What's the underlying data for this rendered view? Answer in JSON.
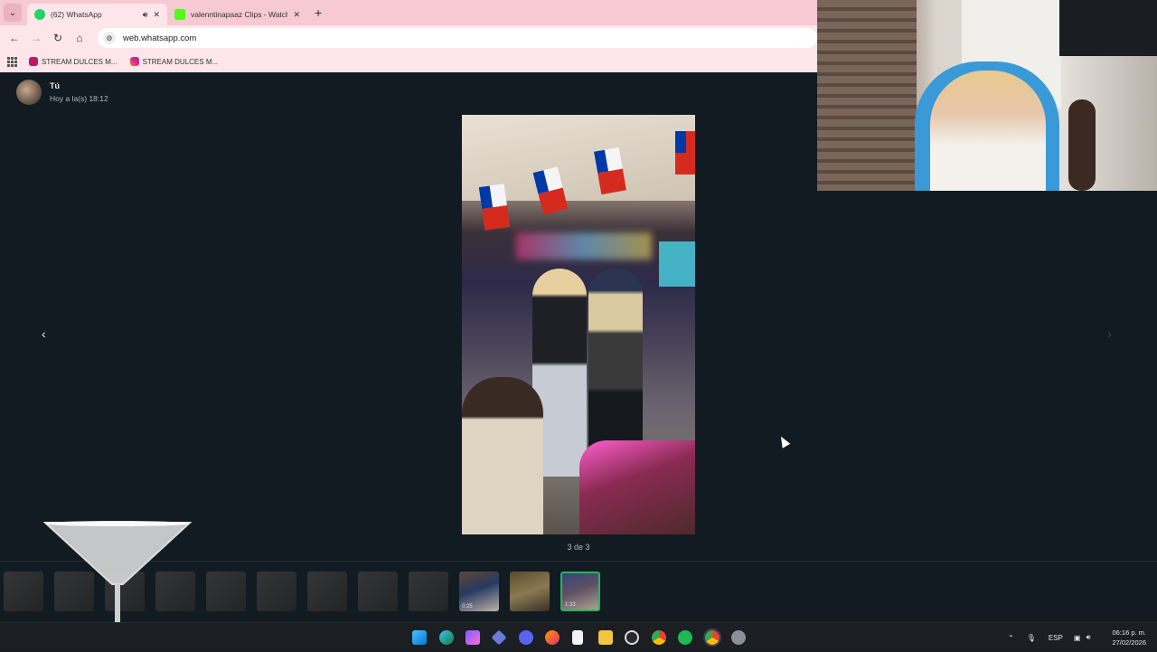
{
  "browser": {
    "tabs": [
      {
        "title": "(62) WhatsApp",
        "active": true,
        "favicon_color": "#25d366"
      },
      {
        "title": "valenntinapaaz Clips - Watch Li",
        "active": false,
        "favicon_color": "#53fc18"
      }
    ],
    "new_tab_label": "+",
    "url": "web.whatsapp.com",
    "bookmarks": [
      {
        "label": "STREAM DULCES M...",
        "color": "#c2185b"
      },
      {
        "label": "STREAM DULCES M...",
        "color": "#e1306c"
      }
    ]
  },
  "viewer": {
    "sender_name": "Tú",
    "sender_time": "Hoy a la(s) 18:12",
    "counter": "3 de 3",
    "prev_arrow": "‹",
    "next_arrow": "›",
    "thumbnails": [
      {
        "type": "image"
      },
      {
        "type": "image"
      },
      {
        "type": "image"
      },
      {
        "type": "image"
      },
      {
        "type": "image"
      },
      {
        "type": "image"
      },
      {
        "type": "image"
      },
      {
        "type": "image"
      },
      {
        "type": "image"
      },
      {
        "type": "video",
        "duration": "0:25"
      },
      {
        "type": "image"
      },
      {
        "type": "video",
        "duration": "1:33",
        "selected": true
      }
    ]
  },
  "taskbar": {
    "icons": [
      "windows-start",
      "edge",
      "copilot",
      "dropbox",
      "discord",
      "firefox",
      "notepad",
      "file-explorer",
      "obs",
      "chrome",
      "spotify",
      "chrome-alt",
      "settings"
    ],
    "tray_lang": "ESP",
    "time": "06:16 p. m.",
    "date": "27/02/2026"
  },
  "colors": {
    "accent": "#25d366",
    "viewer_bg": "#111b21",
    "chrome_bg": "#f6c9d3"
  }
}
